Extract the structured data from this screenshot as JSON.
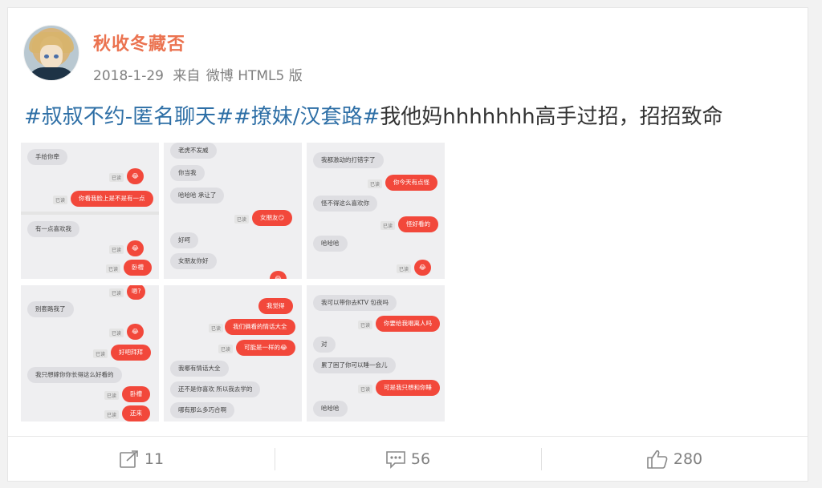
{
  "post": {
    "username": "秋收冬藏否",
    "date": "2018-1-29",
    "source_prefix": "来自",
    "source": "微博 HTML5 版",
    "hashtag1": "#叔叔不约-匿名聊天#",
    "hashtag2": "#撩妹/汉套路#",
    "text": "我他妈hhhhhhh高手过招，招招致命"
  },
  "images": {
    "read_label": "已读",
    "shot1": {
      "msgs": [
        "手给你牵",
        "😂",
        "你看我脸上是不是有一点",
        "有一点喜欢我",
        "😂",
        "卧槽"
      ]
    },
    "shot2": {
      "msgs": [
        "老虎不发威",
        "你当我",
        "哈哈哈 承让了",
        "女朋友😏",
        "好呵",
        "女朋友你好",
        "😂"
      ]
    },
    "shot3": {
      "msgs": [
        "我都激动的打错字了",
        "你今天有点怪",
        "怪不得这么喜欢你",
        "怪好看的",
        "哈哈哈",
        "😂"
      ]
    },
    "shot4": {
      "msgs": [
        "嗯?",
        "别套路我了",
        "😂",
        "好吧拜拜",
        "我只想嫁你你长得这么好看的",
        "卧槽",
        "还来"
      ]
    },
    "shot5": {
      "msgs": [
        "我觉得",
        "我们俩看的情话大全",
        "可能是一样的😂",
        "我哪有情话大全",
        "还不是你喜欢 所以我去学的",
        "哪有那么多巧合啊"
      ]
    },
    "shot6": {
      "msgs": [
        "我可以带你去KTV 包夜吗",
        "你要给我唱离人吗",
        "对",
        "累了困了你可以睡一会儿",
        "可是我只想和你睡",
        "哈哈哈"
      ]
    }
  },
  "actions": {
    "repost_count": "11",
    "comment_count": "56",
    "like_count": "280"
  },
  "colors": {
    "username": "#eb7350",
    "hashtag": "#2e6fa6",
    "bubble_red": "#f2483b"
  }
}
